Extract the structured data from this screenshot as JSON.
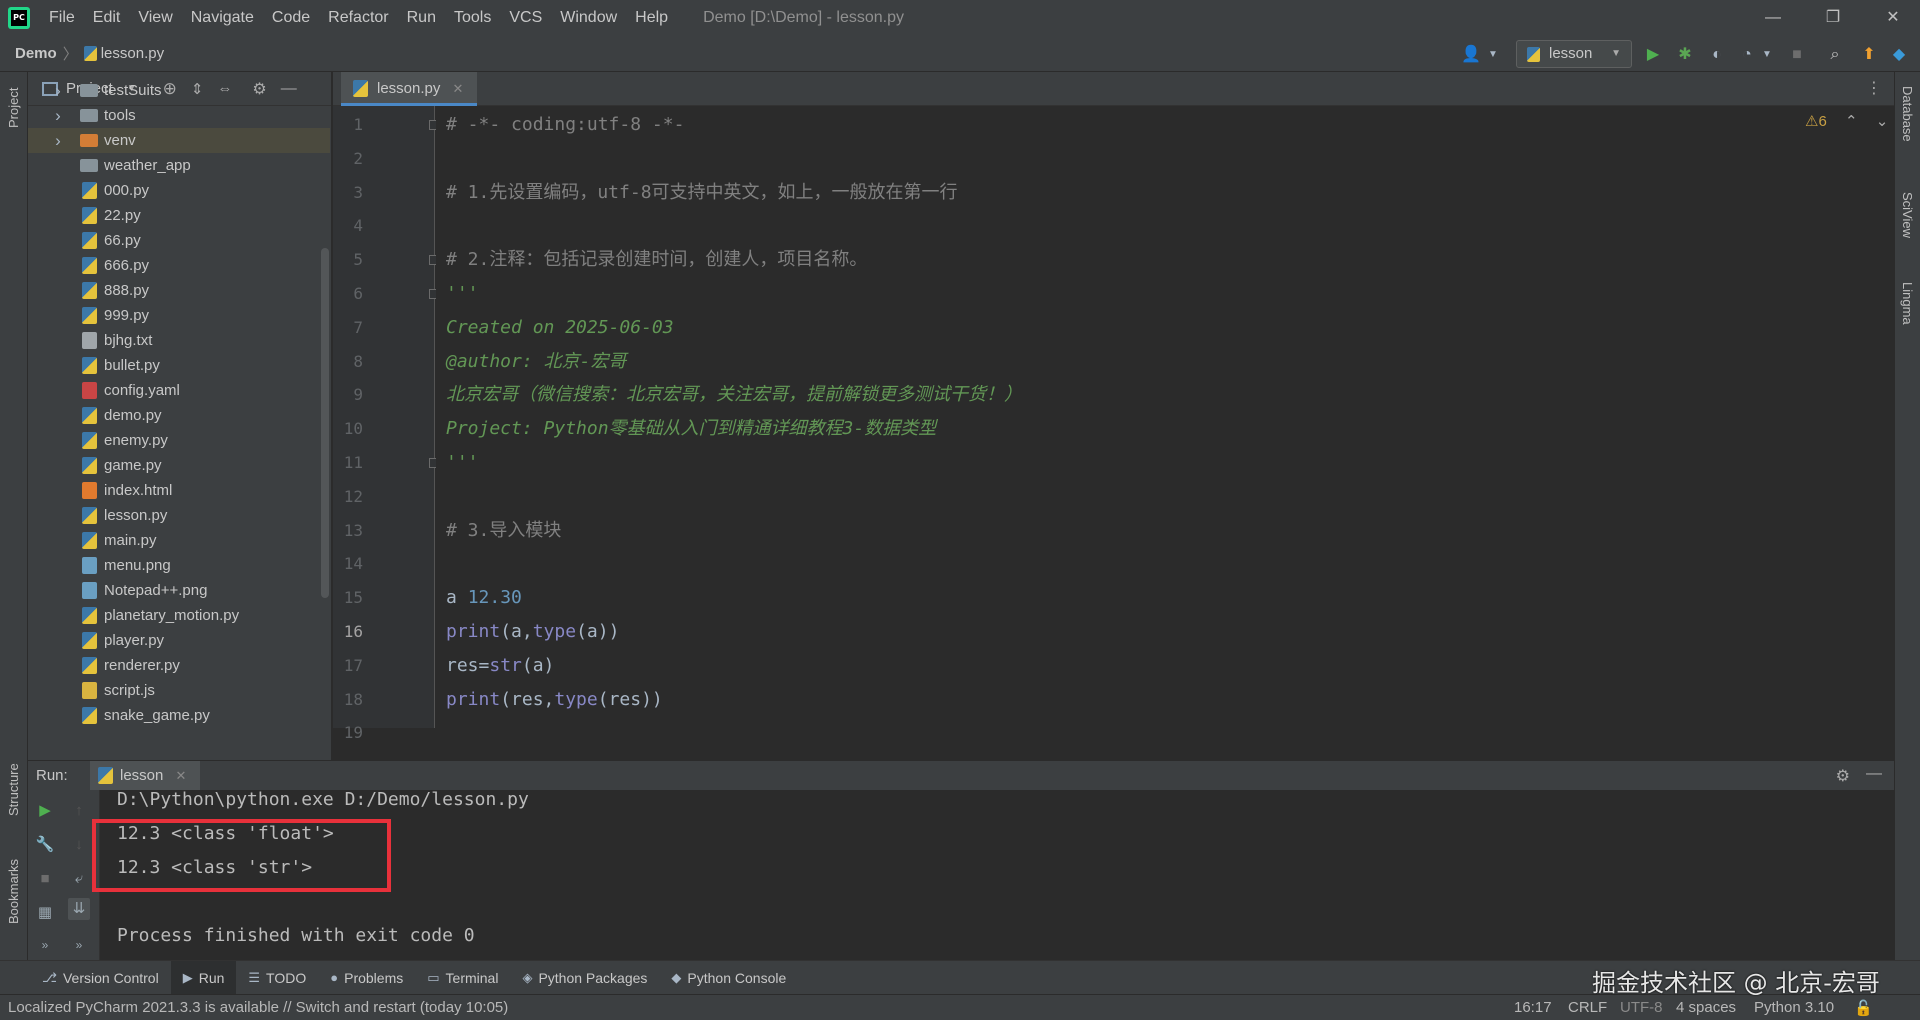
{
  "menu": {
    "items": [
      "File",
      "Edit",
      "View",
      "Navigate",
      "Code",
      "Refactor",
      "Run",
      "Tools",
      "VCS",
      "Window",
      "Help"
    ],
    "window_title": "Demo [D:\\Demo] - lesson.py"
  },
  "window_controls": {
    "minimize": "—",
    "restore": "❐",
    "close": "✕"
  },
  "navbar": {
    "project": "Demo",
    "separator": "〉",
    "file": "lesson.py"
  },
  "toolbar": {
    "run_config": "lesson"
  },
  "left_strip": {
    "project": "Project",
    "structure": "Structure",
    "bookmarks": "Bookmarks"
  },
  "right_strip": {
    "database": "Database",
    "sciview": "SciView",
    "lingma": "Lingma"
  },
  "project_panel": {
    "title": "Project",
    "tree": [
      {
        "label": "testSuits",
        "kind": "folder",
        "expandable": true
      },
      {
        "label": "tools",
        "kind": "folder",
        "expandable": true
      },
      {
        "label": "venv",
        "kind": "venv",
        "expandable": true
      },
      {
        "label": "weather_app",
        "kind": "folder",
        "expandable": false
      },
      {
        "label": "000.py",
        "kind": "py"
      },
      {
        "label": "22.py",
        "kind": "py"
      },
      {
        "label": "66.py",
        "kind": "py"
      },
      {
        "label": "666.py",
        "kind": "py"
      },
      {
        "label": "888.py",
        "kind": "py"
      },
      {
        "label": "999.py",
        "kind": "py"
      },
      {
        "label": "bjhg.txt",
        "kind": "txt"
      },
      {
        "label": "bullet.py",
        "kind": "py"
      },
      {
        "label": "config.yaml",
        "kind": "yaml"
      },
      {
        "label": "demo.py",
        "kind": "py"
      },
      {
        "label": "enemy.py",
        "kind": "py"
      },
      {
        "label": "game.py",
        "kind": "py"
      },
      {
        "label": "index.html",
        "kind": "html"
      },
      {
        "label": "lesson.py",
        "kind": "py"
      },
      {
        "label": "main.py",
        "kind": "py"
      },
      {
        "label": "menu.png",
        "kind": "png"
      },
      {
        "label": "Notepad++.png",
        "kind": "png"
      },
      {
        "label": "planetary_motion.py",
        "kind": "py"
      },
      {
        "label": "player.py",
        "kind": "py"
      },
      {
        "label": "renderer.py",
        "kind": "py"
      },
      {
        "label": "script.js",
        "kind": "js"
      },
      {
        "label": "snake_game.py",
        "kind": "py"
      }
    ]
  },
  "editor": {
    "tab": "lesson.py",
    "inspection": "⚠6",
    "current_line": 16,
    "lines": [
      {
        "n": "1",
        "segs": [
          [
            "c-comment",
            "# -*- coding:utf-8 -*-"
          ]
        ]
      },
      {
        "n": "2",
        "segs": []
      },
      {
        "n": "3",
        "segs": [
          [
            "c-comment",
            "# 1.先设置编码，utf-8可支持中英文，如上，一般放在第一行"
          ]
        ]
      },
      {
        "n": "4",
        "segs": []
      },
      {
        "n": "5",
        "segs": [
          [
            "c-comment",
            "# 2.注释：包括记录创建时间，创建人，项目名称。"
          ]
        ]
      },
      {
        "n": "6",
        "segs": [
          [
            "c-doc",
            "'''"
          ]
        ]
      },
      {
        "n": "7",
        "segs": [
          [
            "c-doc",
            "Created on 2025-06-03"
          ]
        ]
      },
      {
        "n": "8",
        "segs": [
          [
            "c-doc",
            "@author: 北京-宏哥"
          ]
        ]
      },
      {
        "n": "9",
        "segs": [
          [
            "c-doc",
            "北京宏哥（微信搜索：北京宏哥，关注宏哥，提前解锁更多测试干货！）"
          ]
        ]
      },
      {
        "n": "10",
        "segs": [
          [
            "c-doc",
            "Project: Python零基础从入门到精通详细教程3-数据类型"
          ]
        ]
      },
      {
        "n": "11",
        "segs": [
          [
            "c-doc",
            "'''"
          ]
        ]
      },
      {
        "n": "12",
        "segs": []
      },
      {
        "n": "13",
        "segs": [
          [
            "c-comment",
            "# 3.导入模块"
          ]
        ]
      },
      {
        "n": "14",
        "segs": []
      },
      {
        "n": "15",
        "segs": [
          [
            "c-var",
            "a"
          ],
          [
            "c-var",
            " "
          ],
          [
            "c-num",
            "12.30"
          ]
        ]
      },
      {
        "n": "16",
        "segs": [
          [
            "c-kw",
            "print"
          ],
          [
            "c-var",
            "(a,"
          ],
          [
            "c-kw",
            "type"
          ],
          [
            "c-var",
            "(a))"
          ]
        ]
      },
      {
        "n": "17",
        "segs": [
          [
            "c-var",
            "res="
          ],
          [
            "c-kw",
            "str"
          ],
          [
            "c-var",
            "(a)"
          ]
        ]
      },
      {
        "n": "18",
        "segs": [
          [
            "c-kw",
            "print"
          ],
          [
            "c-var",
            "(res,"
          ],
          [
            "c-kw",
            "type"
          ],
          [
            "c-var",
            "(res))"
          ]
        ]
      },
      {
        "n": "19",
        "segs": []
      }
    ]
  },
  "run_panel": {
    "label": "Run:",
    "tab": "lesson",
    "console": [
      "D:\\Python\\python.exe D:/Demo/lesson.py",
      "12.3 <class 'float'>",
      "12.3 <class 'str'>",
      "",
      "Process finished with exit code 0"
    ]
  },
  "tool_tabs": [
    {
      "label": "Version Control",
      "icon": "⎇"
    },
    {
      "label": "Run",
      "icon": "▶"
    },
    {
      "label": "TODO",
      "icon": "☰"
    },
    {
      "label": "Problems",
      "icon": "●"
    },
    {
      "label": "Terminal",
      "icon": "▭"
    },
    {
      "label": "Python Packages",
      "icon": "◈"
    },
    {
      "label": "Python Console",
      "icon": "◆"
    }
  ],
  "statusbar": {
    "message": "Localized PyCharm 2021.3.3 is available // Switch and restart (today 10:05)",
    "position": "16:17",
    "line_sep": "CRLF",
    "encoding": "UTF-8",
    "indent": "4 spaces",
    "interpreter": "Python 3.10"
  },
  "watermark": "掘金技术社区 @ 北京-宏哥",
  "colors": {
    "accent": "#4a88c7",
    "highlight_box": "#e8313b",
    "run_green": "#4fb050",
    "doc_string": "#629755"
  }
}
